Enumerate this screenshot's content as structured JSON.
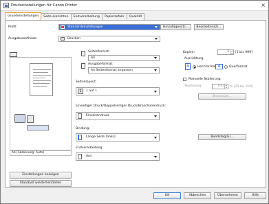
{
  "window": {
    "title": "Druckeinstellungen für Canon Printer"
  },
  "tabs": [
    {
      "label": "Grundeinstellungen"
    },
    {
      "label": "Seite einrichten"
    },
    {
      "label": "Endverarbeitung"
    },
    {
      "label": "Papierzufuhr"
    },
    {
      "label": "Qualität"
    }
  ],
  "profile": {
    "label": "Profil:",
    "value": "Standardeinstellungen",
    "add_button": "Hinzufügen(1)...",
    "edit_button": "Bearbeiten(2)..."
  },
  "output_method": {
    "label": "Ausgabemethode:",
    "value": "Drucken"
  },
  "page_size": {
    "label": "Seitenformat:",
    "value": "A4"
  },
  "output_size": {
    "label": "Ausgabeformat:",
    "value": "An Seitenformat anpassen"
  },
  "copies": {
    "label": "Kopien:",
    "value": "1",
    "range": "[1 bis 999]"
  },
  "orientation": {
    "label": "Ausrichtung",
    "portrait": "Hochformat",
    "landscape": "Querformat",
    "selected": "portrait"
  },
  "manual_scaling": {
    "label": "Manuelle Skalierung",
    "checked": false
  },
  "scaling": {
    "label": "Skalierung:",
    "value": "100",
    "range": "% [25 bis 200]"
  },
  "page_layout": {
    "label": "Seitenlayout:",
    "value": "1 auf 1"
  },
  "booklet_button": "Broschüre...",
  "print_mode": {
    "label": "Einseitiger Druck/Doppelseitiger Druck/Broschürendruck:",
    "value": "Einseitendruck"
  },
  "binding": {
    "label": "Bindung:",
    "value": "Lange Seite [links]"
  },
  "binding_button": "Bundsteg(G)...",
  "finishing": {
    "label": "Endverarbeitung:",
    "value": "Aus"
  },
  "preview_status": "A4 [Skalierung: Auto]",
  "left_buttons": {
    "show_settings": "Einstellungen anzeigen",
    "restore_defaults": "Standard wiederherstellen"
  },
  "footer": {
    "ok": "OK",
    "cancel": "Abbrechen",
    "apply": "Übernehmen",
    "help": "Hilfe"
  },
  "colors": {
    "tab_highlight": "#e79a23",
    "selection": "#3a6fd8"
  }
}
